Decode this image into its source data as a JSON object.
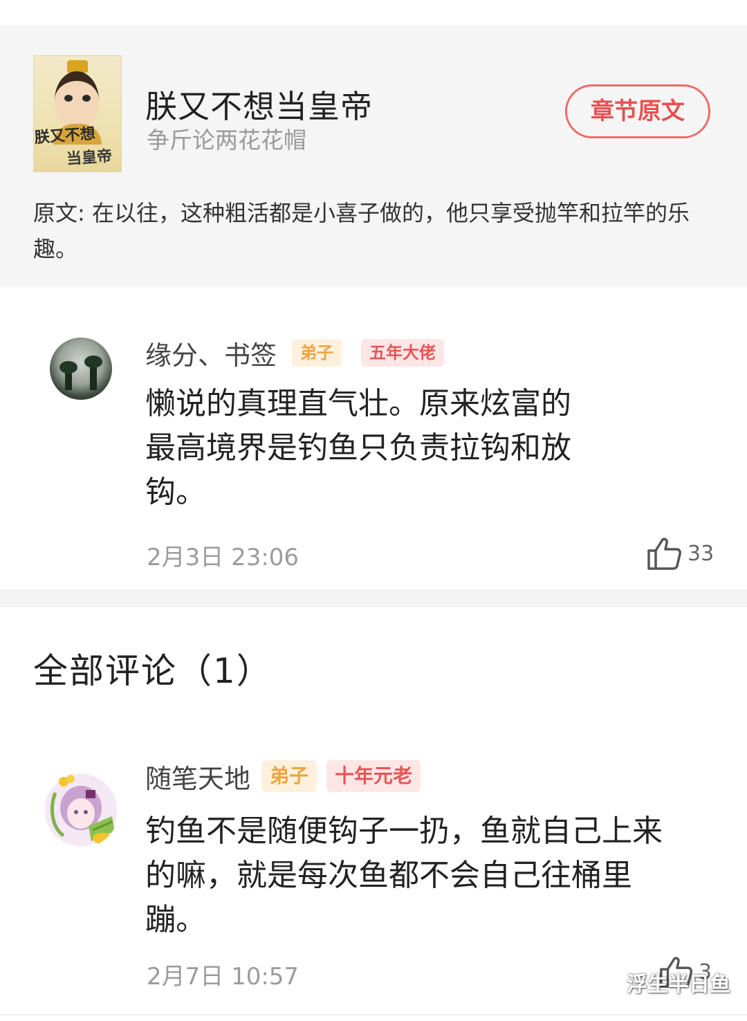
{
  "book": {
    "cover_title_line1": "朕又不想",
    "cover_title_line2": "当皇帝",
    "title": "朕又不想当皇帝",
    "author": "争斤论两花花帽",
    "chapter_button": "章节原文",
    "quote": "原文: 在以往，这种粗活都是小喜子做的，他只享受抛竿和拉竿的乐趣。"
  },
  "featured_comment": {
    "username": "缘分、书签",
    "badges": [
      "弟子",
      "五年大佬"
    ],
    "text_lines": [
      "懒说的真理直气壮。原来炫富的",
      "最高境界是钓鱼只负责拉钩和放",
      "钩。"
    ],
    "time": "2月3日 23:06",
    "likes": "33",
    "like_icon": "thumbs-up-icon"
  },
  "all_comments": {
    "title": "全部评论（1）",
    "items": [
      {
        "username": "随笔天地",
        "badges": [
          "弟子",
          "十年元老"
        ],
        "text_lines": [
          "钓鱼不是随便钩子一扔，鱼就自己上来",
          "的嘛，就是每次鱼都不会自己往桶里",
          "蹦。"
        ],
        "time": "2月7日 10:57",
        "likes": "3",
        "like_icon": "thumbs-up-icon"
      }
    ]
  },
  "watermark": "浮生半日鱼",
  "colors": {
    "accent_red": "#e8504f",
    "badge_orange": "#f0a43c",
    "badge_red": "#e85454",
    "header_bg": "#f5f5f5"
  }
}
